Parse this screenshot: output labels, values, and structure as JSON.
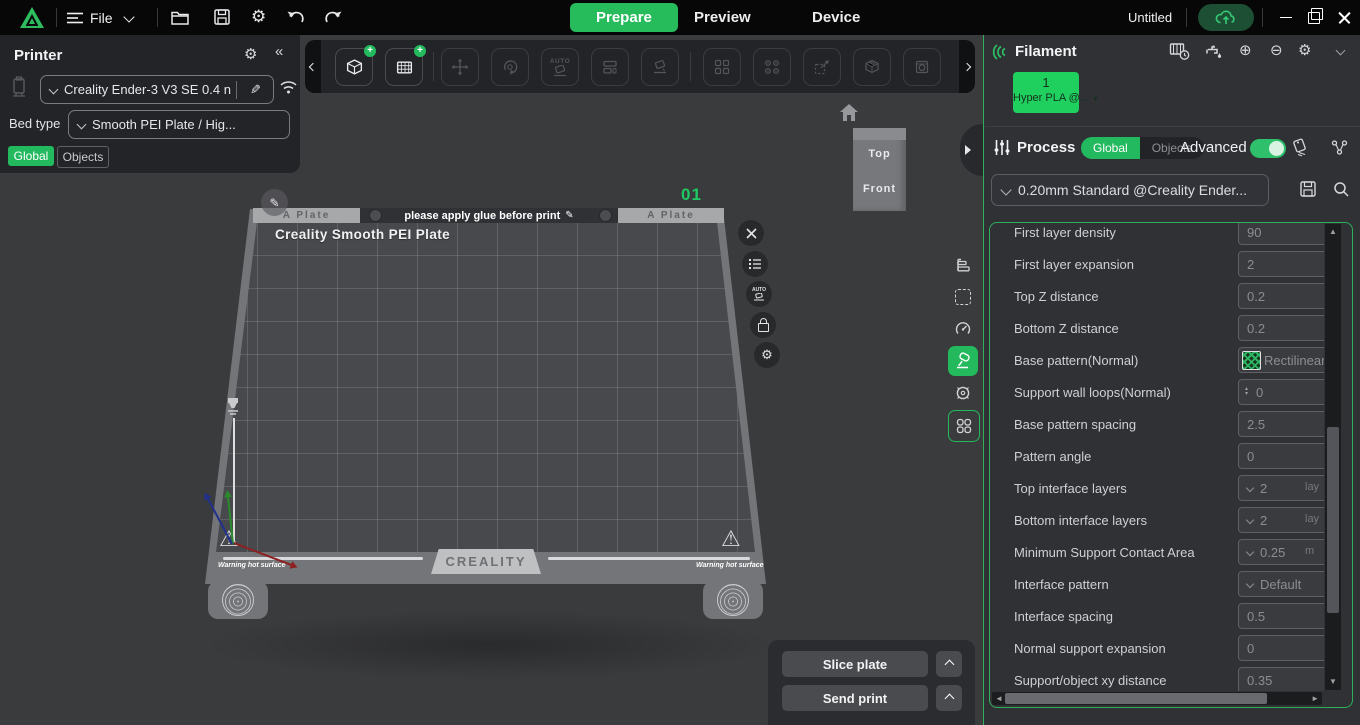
{
  "topbar": {
    "file_label": "File",
    "tabs": [
      {
        "label": "Prepare",
        "active": true
      },
      {
        "label": "Preview",
        "active": false
      },
      {
        "label": "Device",
        "active": false
      }
    ],
    "doc_title": "Untitled"
  },
  "printer_panel": {
    "title": "Printer",
    "printer_name": "Creality Ender-3 V3 SE 0.4 n",
    "bed_type_label": "Bed type",
    "bed_type_value": "Smooth PEI Plate / Hig...",
    "scope_tabs": [
      {
        "label": "Global",
        "active": true
      },
      {
        "label": "Objects",
        "active": false
      }
    ]
  },
  "viewport": {
    "toolbar": {
      "auto_label": "AUTO"
    },
    "plate": {
      "number": "01",
      "clip_left": "A Plate",
      "clip_right": "A Plate",
      "glue_hint": "please apply glue before print",
      "surface_label": "Creality Smooth PEI Plate",
      "brand": "CREALITY",
      "warning_left": "Warning hot surface",
      "warning_right": "Warning hot surface"
    },
    "navcube": {
      "top": "Top",
      "front": "Front"
    }
  },
  "filament": {
    "title": "Filament",
    "slot_number": "1",
    "slot_name": "Hyper PLA @..."
  },
  "process": {
    "title": "Process",
    "scope_tabs": [
      {
        "label": "Global",
        "active": true
      },
      {
        "label": "Objects",
        "active": false
      }
    ],
    "advanced_label": "Advanced",
    "advanced_on": true,
    "preset": "0.20mm Standard @Creality Ender...",
    "params": [
      {
        "label": "First layer density",
        "value": "90",
        "type": "input"
      },
      {
        "label": "First layer expansion",
        "value": "2",
        "type": "input"
      },
      {
        "label": "Top Z distance",
        "value": "0.2",
        "type": "input"
      },
      {
        "label": "Bottom Z distance",
        "value": "0.2",
        "type": "input"
      },
      {
        "label": "Base pattern(Normal)",
        "value": "Rectilinear",
        "type": "pattern"
      },
      {
        "label": "Support wall loops(Normal)",
        "value": "0",
        "type": "spinner"
      },
      {
        "label": "Base pattern spacing",
        "value": "2.5",
        "type": "input"
      },
      {
        "label": "Pattern angle",
        "value": "0",
        "type": "input"
      },
      {
        "label": "Top interface layers",
        "value": "2",
        "unit": "lay",
        "type": "select"
      },
      {
        "label": "Bottom interface layers",
        "value": "2",
        "unit": "lay",
        "type": "select"
      },
      {
        "label": "Minimum Support Contact Area",
        "value": "0.25",
        "unit": "m",
        "type": "select"
      },
      {
        "label": "Interface pattern",
        "value": "Default",
        "type": "select"
      },
      {
        "label": "Interface spacing",
        "value": "0.5",
        "type": "input"
      },
      {
        "label": "Normal support expansion",
        "value": "0",
        "type": "input"
      },
      {
        "label": "Support/object xy distance",
        "value": "0.35",
        "type": "input"
      }
    ]
  },
  "actions": {
    "slice_label": "Slice plate",
    "send_label": "Send print"
  },
  "colors": {
    "accent_green": "#23bb5e",
    "chip_green": "#1fd05e",
    "panel_border_green": "#2fae5b",
    "plate_number_green": "#1fca62",
    "topbar_black": "#070708",
    "viewport_gray": "#3a3b3d",
    "panel_gray": "#303135"
  }
}
